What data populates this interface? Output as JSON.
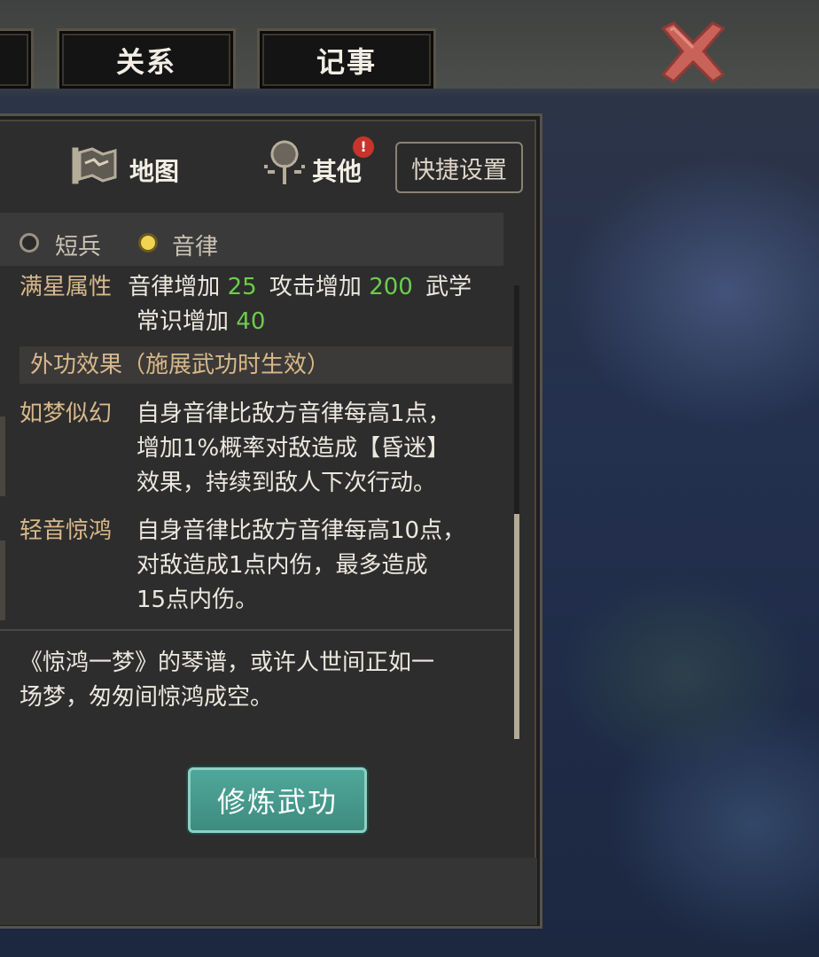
{
  "tabs": [
    {
      "label": ""
    },
    {
      "label": "关系"
    },
    {
      "label": "记事"
    }
  ],
  "panel_nav": {
    "map_label": "地图",
    "other_label": "其他",
    "other_badge": "!",
    "quick_settings_label": "快捷设置"
  },
  "filters": [
    {
      "label": "短兵",
      "selected": false
    },
    {
      "label": "音律",
      "selected": true
    }
  ],
  "skill_detail": {
    "full_attr_line1_label": "满星属性",
    "full_attr_line1_a": "音律增加",
    "full_attr_line1_a_val": "25",
    "full_attr_line1_b": "攻击增加",
    "full_attr_line1_b_val": "200",
    "full_attr_line1_c": "武学",
    "full_attr_line2_a": "常识增加",
    "full_attr_line2_a_val": "40",
    "external_effect_header": "外功效果（施展武功时生效）",
    "effects": [
      {
        "name": "如梦似幻",
        "lines": [
          "自身音律比敌方音律每高1点，",
          "增加1%概率对敌造成【昏迷】",
          "效果，持续到敌人下次行动。"
        ]
      },
      {
        "name": "轻音惊鸿",
        "lines": [
          "自身音律比敌方音律每高10点，",
          "对敌造成1点内伤，最多造成",
          "15点内伤。"
        ]
      }
    ],
    "description_lines": [
      "《惊鸿一梦》的琴谱，或许人世间正如一",
      "场梦，匆匆间惊鸿成空。"
    ]
  },
  "train_button_label": "修炼武功",
  "colors": {
    "accent_green": "#6ccc4e",
    "title_tan": "#d8b88a",
    "button_teal": "#4fa79a",
    "close_red": "#c96259"
  },
  "icons": [
    "map-icon",
    "other-icon",
    "close-icon"
  ]
}
